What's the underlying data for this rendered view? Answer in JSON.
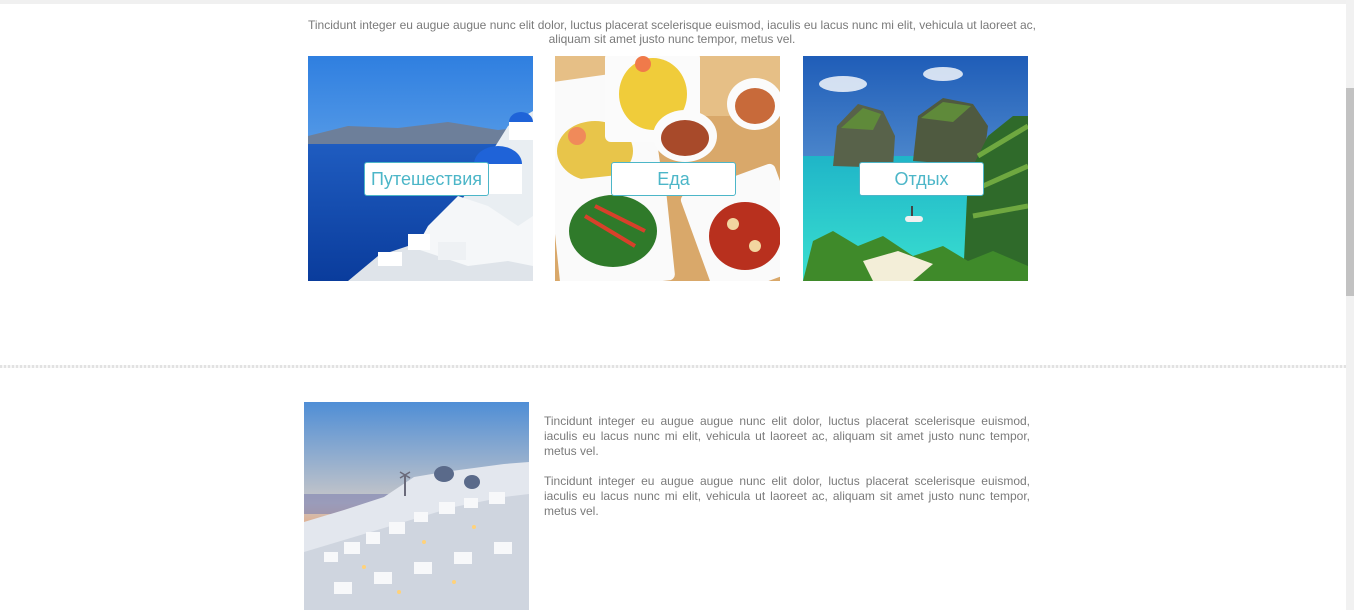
{
  "intro": {
    "text": "Tincidunt integer eu augue augue nunc elit dolor, luctus placerat scelerisque euismod, iaculis eu lacus nunc mi elit, vehicula ut laoreet ac, aliquam sit amet justo nunc tempor, metus vel."
  },
  "cards": [
    {
      "label": "Путешествия",
      "image": "santorini-coast-photo"
    },
    {
      "label": "Еда",
      "image": "asian-food-plates-photo"
    },
    {
      "label": "Отдых",
      "image": "tropical-beach-photo"
    }
  ],
  "feature": {
    "image": "santorini-sunset-village-photo",
    "paragraphs": [
      "Tincidunt integer eu augue augue nunc elit dolor, luctus placerat scelerisque euismod, iaculis eu lacus nunc mi elit, vehicula ut laoreet ac, aliquam sit amet justo nunc tempor, metus vel.",
      "Tincidunt integer eu augue augue nunc elit dolor, luctus placerat scelerisque euismod, iaculis eu lacus nunc mi elit, vehicula ut laoreet ac, aliquam sit amet justo nunc tempor, metus vel."
    ]
  },
  "colors": {
    "accent": "#4cb6c8",
    "text": "#7a7a7a",
    "background": "#ffffff"
  }
}
